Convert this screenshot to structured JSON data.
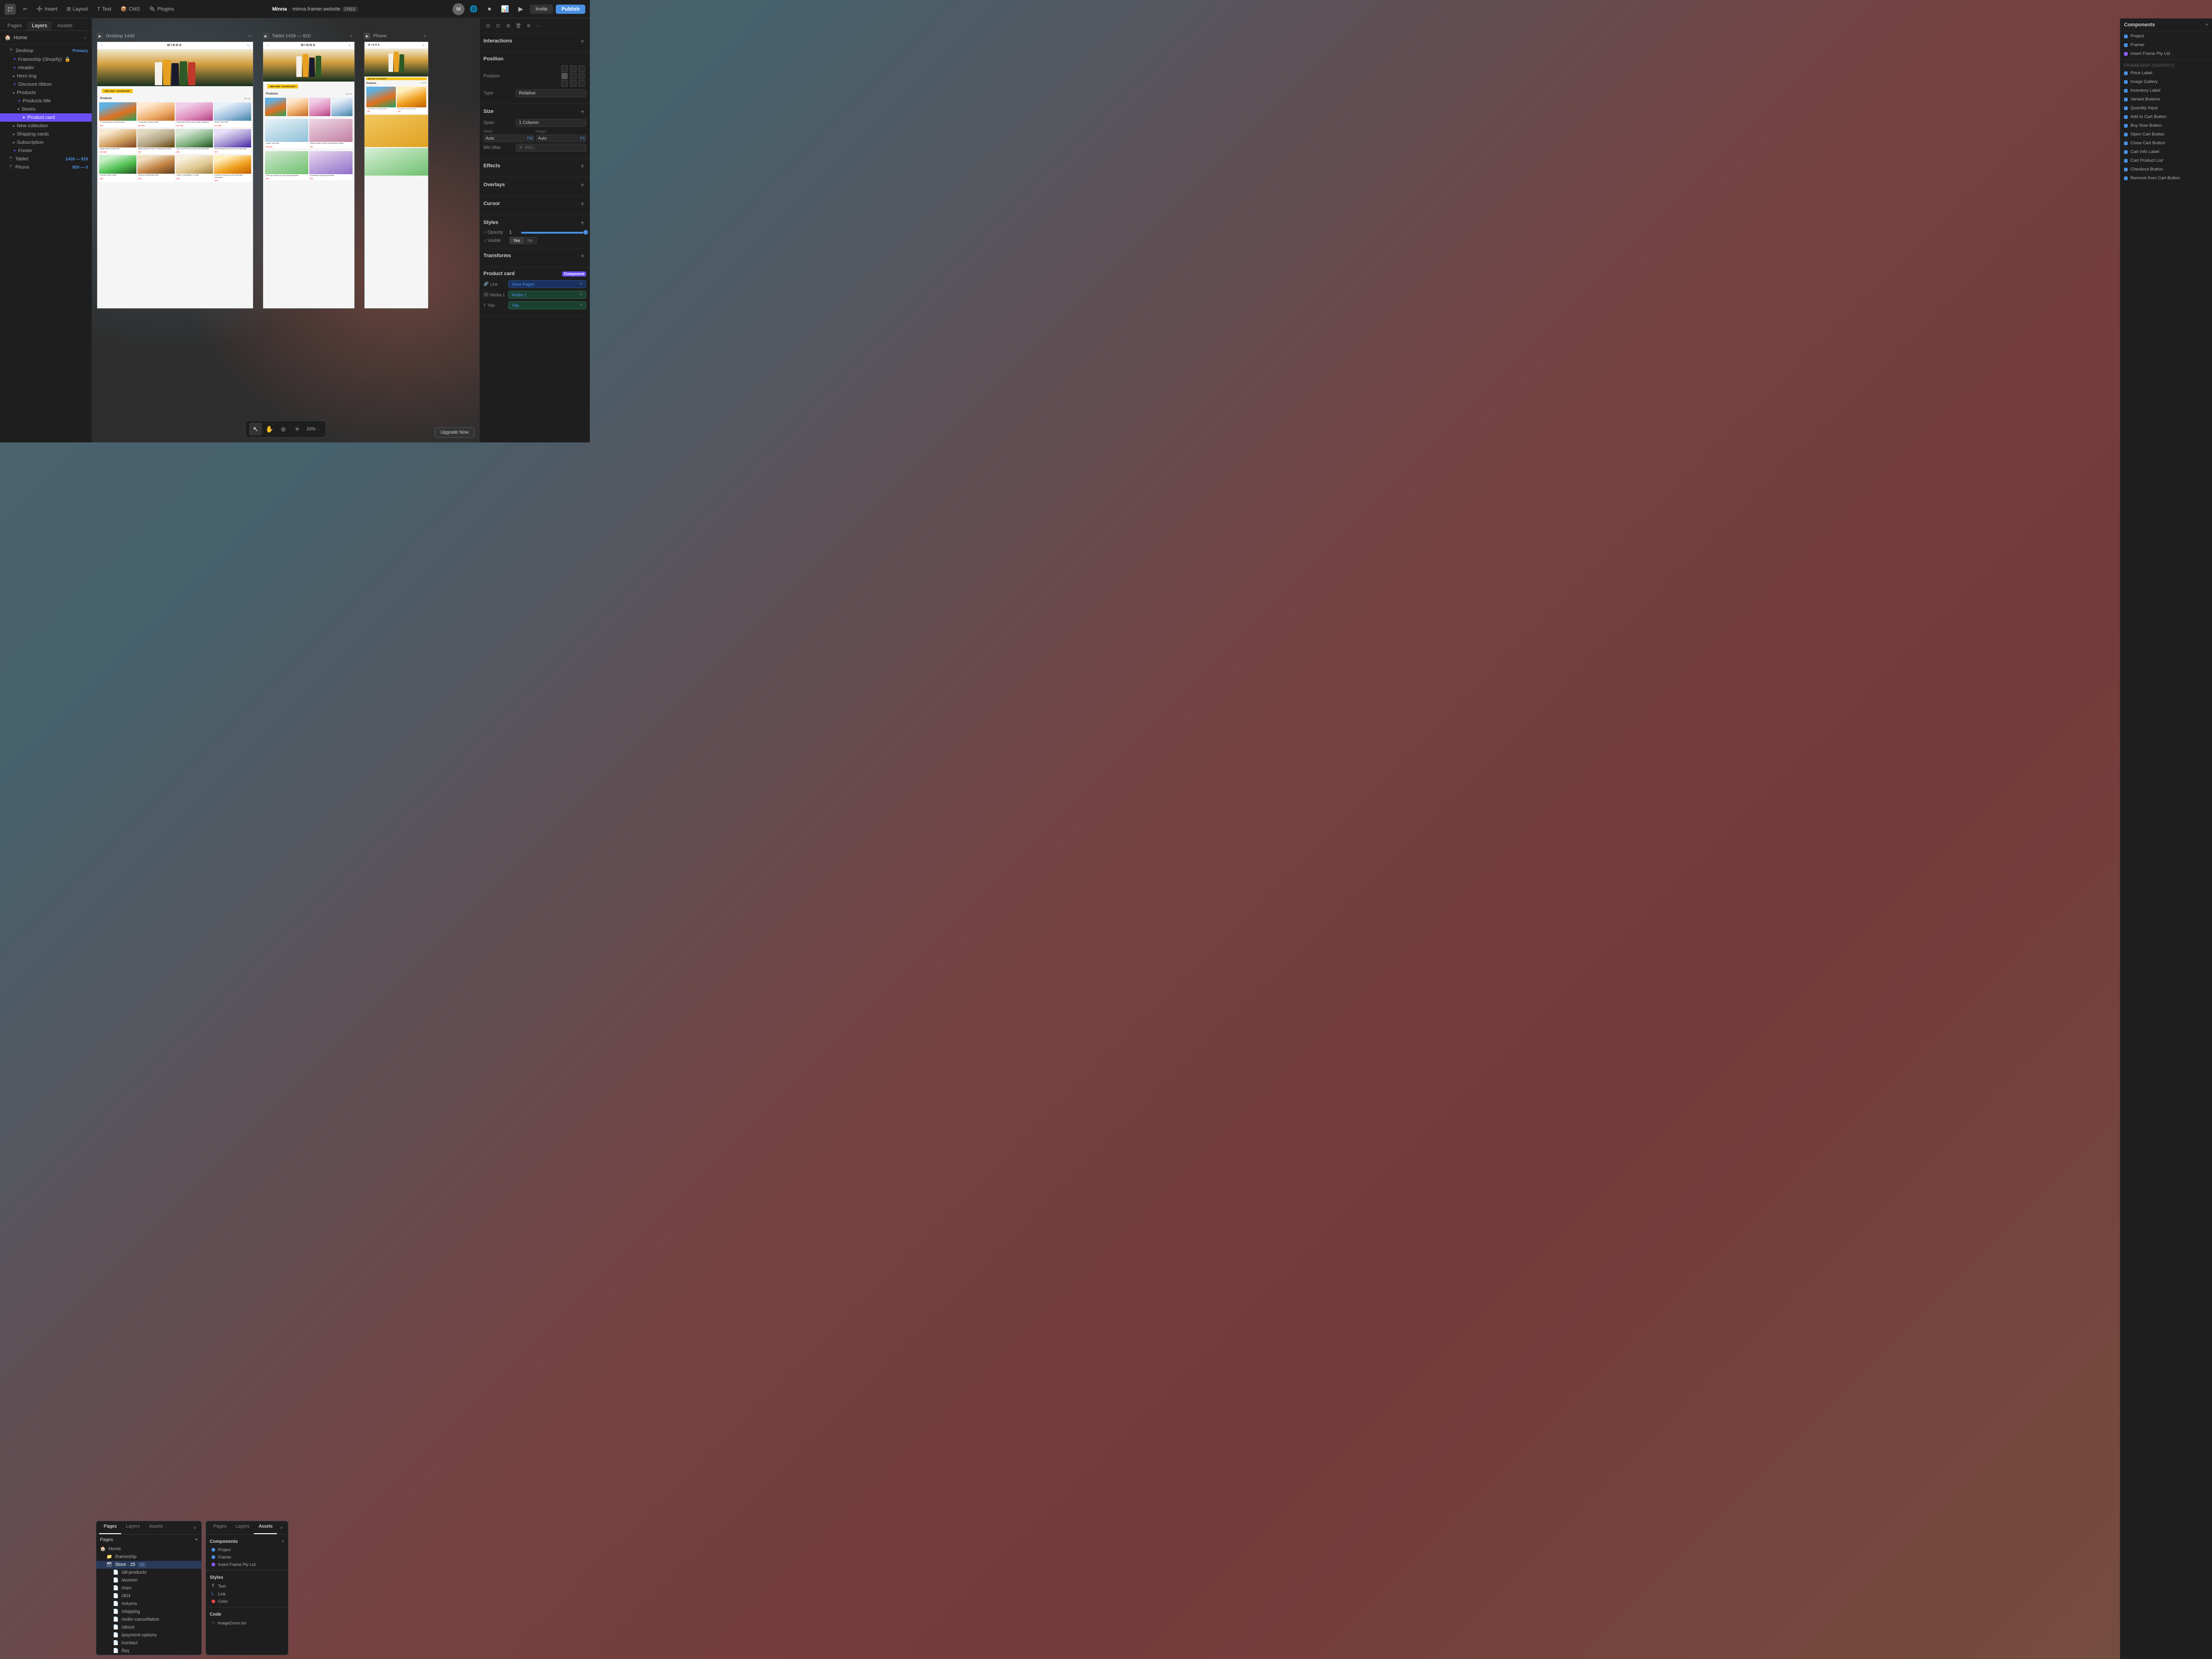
{
  "toolbar": {
    "logo": "F",
    "tools": [
      "Insert",
      "Layout",
      "Text",
      "CMS",
      "Plugins"
    ],
    "tool_icons": [
      "➕",
      "⊞",
      "T",
      "📦",
      "🔌"
    ],
    "site_name": "Minna",
    "site_url": "minna.framer.website",
    "site_badge": "FREE",
    "invite_label": "Invite",
    "publish_label": "Publish"
  },
  "left_sidebar": {
    "tabs": [
      "Pages",
      "Layers",
      "Assets"
    ],
    "active_tab": "Layers",
    "home_label": "Home",
    "layers": [
      {
        "label": "Desktop",
        "indent": 1,
        "icon": "frame",
        "badge": "Primary"
      },
      {
        "label": "Frameship (Shopify)",
        "indent": 2,
        "icon": "component",
        "lock": true
      },
      {
        "label": "Header",
        "indent": 2,
        "icon": "component"
      },
      {
        "label": "Hero img",
        "indent": 2,
        "icon": "group"
      },
      {
        "label": "Discount ribbon",
        "indent": 2,
        "icon": "component"
      },
      {
        "label": "Products",
        "indent": 2,
        "icon": "group"
      },
      {
        "label": "Products title",
        "indent": 3,
        "icon": "component"
      },
      {
        "label": "Stores",
        "indent": 3,
        "icon": "group"
      },
      {
        "label": "Product card",
        "indent": 4,
        "icon": "component",
        "selected": true
      },
      {
        "label": "New collection",
        "indent": 2,
        "icon": "group"
      },
      {
        "label": "Shipping cards",
        "indent": 2,
        "icon": "group"
      },
      {
        "label": "Subscription",
        "indent": 2,
        "icon": "group"
      },
      {
        "label": "Footer",
        "indent": 2,
        "icon": "component"
      },
      {
        "label": "Tablet",
        "indent": 1,
        "icon": "frame",
        "badge": "1439 — 810"
      },
      {
        "label": "Phone",
        "indent": 1,
        "icon": "frame",
        "badge": "809 — 0"
      }
    ]
  },
  "frames": [
    {
      "label": "Desktop 1440",
      "icon": "▶"
    },
    {
      "label": "Tablet 1439 — 810",
      "icon": "▶"
    },
    {
      "label": "Phone",
      "icon": "▶"
    }
  ],
  "right_panel": {
    "sections": {
      "interactions": "Interactions",
      "position": "Position",
      "size": "Size",
      "effects": "Effects",
      "overlays": "Overlays",
      "cursor": "Cursor",
      "styles": "Styles",
      "transforms": "Transforms"
    },
    "position_value": "Position",
    "position_type": "Relative",
    "size_span": "1 Column",
    "size_width": "Auto",
    "size_fill": "Fill",
    "size_height": "Auto",
    "size_fit": "Fit",
    "min_max_label": "Min Max",
    "opacity_value": "1",
    "visible_yes": "Yes",
    "visible_no": "No",
    "product_card_label": "Product card",
    "component_label": "Component",
    "link_label": "Link",
    "link_value": "Store Pages",
    "media1_label": "Media 1",
    "media1_value": "Media 1",
    "title_label": "Title",
    "title_value": "Title"
  },
  "bottom_panels": {
    "pages_tabs": [
      "Pages",
      "Layers",
      "Assets"
    ],
    "active_tab": "Assets",
    "pages_title": "Pages",
    "pages_add": "+",
    "pages": [
      {
        "label": "Home",
        "indent": 0
      },
      {
        "label": "/frameship",
        "indent": 1
      },
      {
        "label": "Store · 25",
        "indent": 2,
        "selected": true
      },
      {
        "label": "/all-products",
        "indent": 3
      },
      {
        "label": "/women",
        "indent": 3
      },
      {
        "label": "/men",
        "indent": 3
      },
      {
        "label": "/404",
        "indent": 3
      },
      {
        "label": "/returns",
        "indent": 3
      },
      {
        "label": "/shipping",
        "indent": 3
      },
      {
        "label": "/order-cancellation",
        "indent": 3
      },
      {
        "label": "/about",
        "indent": 3
      },
      {
        "label": "/payment-options",
        "indent": 3
      },
      {
        "label": "/contact",
        "indent": 3
      },
      {
        "label": "/faq",
        "indent": 3
      }
    ],
    "components_title": "Components",
    "components": [
      {
        "label": "Project"
      },
      {
        "label": "Framer"
      },
      {
        "label": "Insert Frame Pty Ltd"
      }
    ],
    "styles_title": "Styles",
    "styles": [
      {
        "label": "Text",
        "type": "T"
      },
      {
        "label": "Link",
        "type": "L"
      },
      {
        "label": "Color",
        "type": "C"
      }
    ],
    "code_title": "Code",
    "code_items": [
      "ImageZoom.tsx"
    ]
  },
  "right_components_panel": {
    "title": "Components",
    "add": "+",
    "sections": [
      {
        "title": "",
        "items": [
          "Project",
          "Framer",
          "Insert Frame Pty Ltd"
        ]
      },
      {
        "title": "Frameship (Shopify)",
        "items": [
          "Price Label",
          "Image Gallery",
          "Inventory Label",
          "Variant Buttons",
          "Quantity Input",
          "Add to Cart Button",
          "Buy Now Button",
          "Open Cart Button",
          "Close Cart Button",
          "Cart Info Label",
          "Cart Product List",
          "Checkout Button",
          "Remove from Cart Button"
        ]
      }
    ]
  },
  "canvas": {
    "zoom": "33%",
    "bottom_tools": [
      "cursor",
      "hand",
      "zoom",
      "sun"
    ],
    "upgrade_label": "Upgrade Now",
    "desktop_products": [
      {
        "img_class": "pcard-man-colorful",
        "title": "A Young Woman in Colorful Jacket",
        "price": "$36"
      },
      {
        "img_class": "pcard-woman-orange",
        "title": "Young Man in Vibrant Jacket",
        "price": "$47 $52"
      },
      {
        "img_class": "pcard-woman-pink-suit",
        "title": "Fashionable Woman with Orange Sunglasses",
        "price": "$47 $54"
      },
      {
        "img_class": "pcard-stretch",
        "title": "Stretch Tee in Milk",
        "price": "$47 $54"
      },
      {
        "img_class": "pcard-model-floral",
        "title": "Stylish Model in Floral Shirt",
        "price": "$36 $45"
      },
      {
        "img_class": "pcard-retro",
        "title": "Stylish Woman in Retro Contemporary Fashion",
        "price": "$47"
      },
      {
        "img_class": "pcard-close-up",
        "title": "Close up of Person in Light Green Activewear",
        "price": "$36"
      },
      {
        "img_class": "pcard-micro",
        "title": "Monochromatic Pink Suit for Non-Activewear",
        "price": "$70"
      }
    ]
  },
  "website_preview": {
    "brand": "MINNA",
    "ribbon": "NEW YEAR · %20 DISCOUNT",
    "products_title": "Products",
    "see_all": "See All"
  }
}
